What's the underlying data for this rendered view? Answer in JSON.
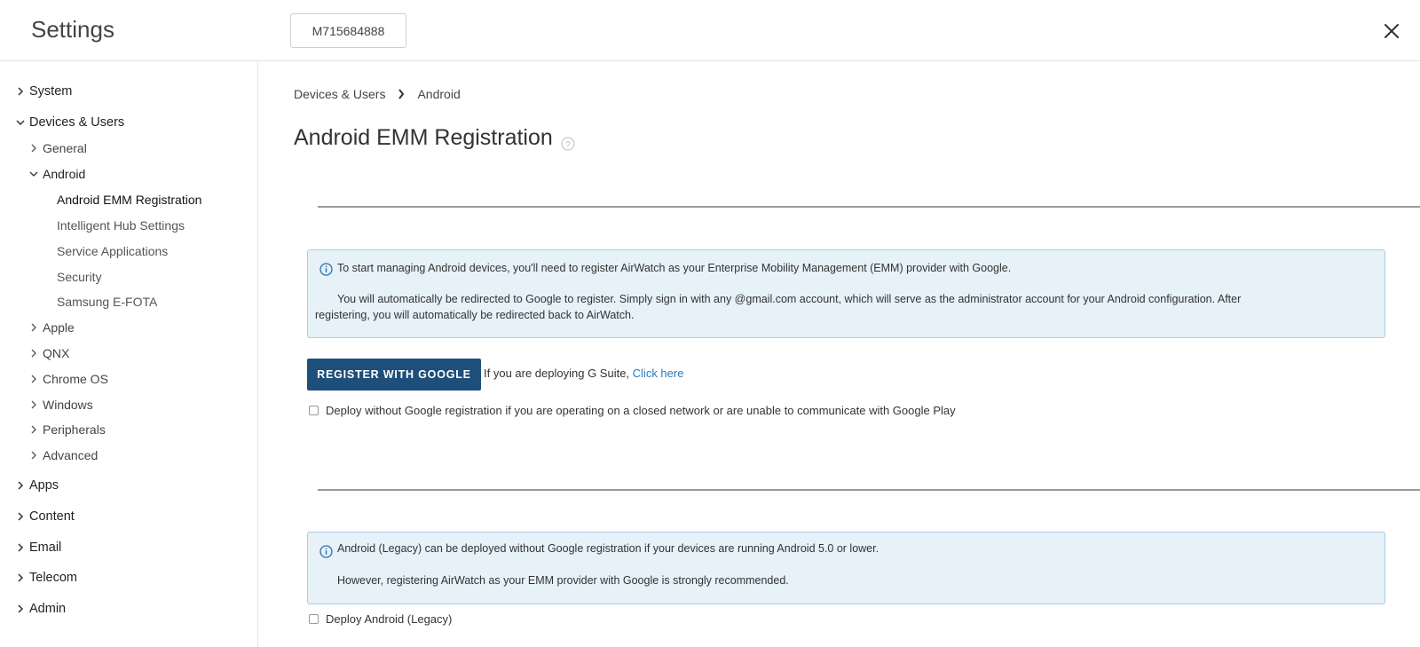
{
  "header": {
    "title": "Settings",
    "org_id": "M715684888"
  },
  "sidebar": {
    "items": [
      {
        "label": "System"
      },
      {
        "label": "Devices & Users"
      },
      {
        "label": "General"
      },
      {
        "label": "Android"
      },
      {
        "label": "Android EMM Registration"
      },
      {
        "label": "Intelligent Hub Settings"
      },
      {
        "label": "Service Applications"
      },
      {
        "label": "Security"
      },
      {
        "label": "Samsung E-FOTA"
      },
      {
        "label": "Apple"
      },
      {
        "label": "QNX"
      },
      {
        "label": "Chrome OS"
      },
      {
        "label": "Windows"
      },
      {
        "label": "Peripherals"
      },
      {
        "label": "Advanced"
      },
      {
        "label": "Apps"
      },
      {
        "label": "Content"
      },
      {
        "label": "Email"
      },
      {
        "label": "Telecom"
      },
      {
        "label": "Admin"
      }
    ]
  },
  "breadcrumb": {
    "items": [
      "Devices & Users",
      "Android"
    ]
  },
  "page": {
    "title": "Android EMM Registration"
  },
  "registration_info": {
    "line1": "To start managing Android devices, you'll need to register AirWatch as your Enterprise Mobility Management (EMM) provider with Google.",
    "line2": "You will automatically be redirected to Google to register. Simply sign in with any @gmail.com account, which will serve as the administrator account for your Android configuration. After",
    "line3": "registering, you will automatically be redirected back to AirWatch."
  },
  "actions": {
    "register_label": "REGISTER WITH GOOGLE",
    "gsuite_text": "If you are deploying G Suite, ",
    "gsuite_link": "Click here"
  },
  "options": {
    "deploy_without_google": "Deploy without Google registration if you are operating on a closed network or are unable to communicate with Google Play",
    "deploy_legacy": "Deploy Android (Legacy)"
  },
  "legacy_info": {
    "line1": "Android (Legacy) can be deployed without Google registration if your devices are running Android 5.0 or lower.",
    "line2": "However, registering AirWatch as your EMM provider with Google is strongly recommended."
  },
  "colors": {
    "primary_button": "#1e4f7a",
    "link": "#2a7bbf",
    "info_bg": "#e6f1f8",
    "info_border": "#a8cde3"
  },
  "icons": {
    "close": "close-icon",
    "chevron_right": "chevron-right-icon",
    "chevron_down": "chevron-down-icon",
    "help": "help-circle-icon",
    "info": "info-circle-icon"
  }
}
